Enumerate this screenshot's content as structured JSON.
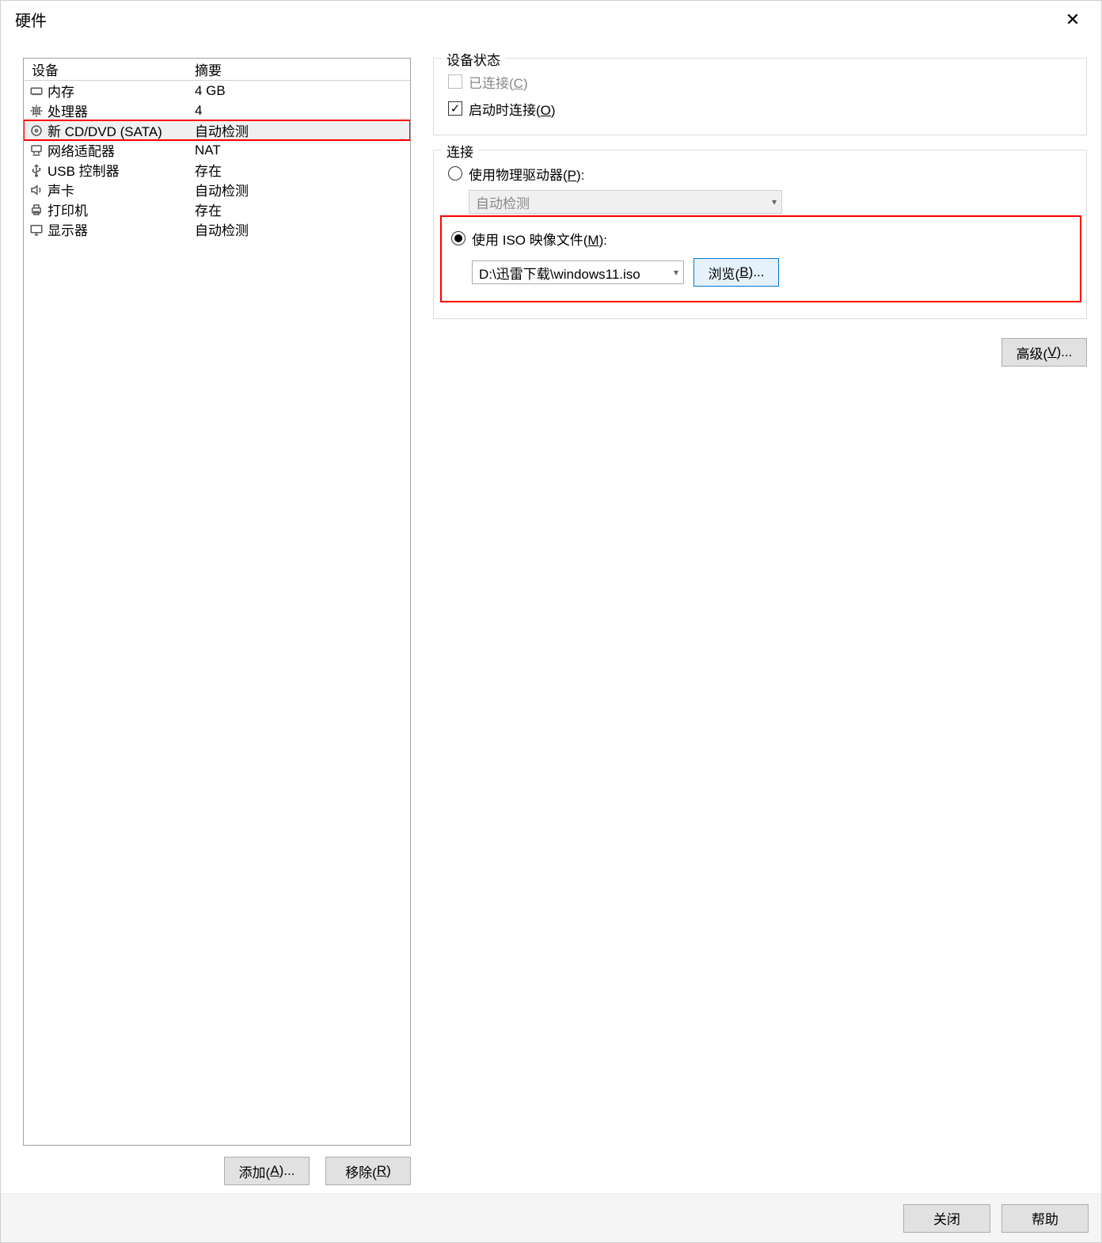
{
  "title": "硬件",
  "device_table": {
    "headers": {
      "device": "设备",
      "summary": "摘要"
    },
    "rows": [
      {
        "icon": "memory",
        "label": "内存",
        "summary": "4 GB",
        "selected": false
      },
      {
        "icon": "cpu",
        "label": "处理器",
        "summary": "4",
        "selected": false
      },
      {
        "icon": "disc",
        "label": "新 CD/DVD (SATA)",
        "summary": "自动检测",
        "selected": true,
        "highlight": true
      },
      {
        "icon": "network",
        "label": "网络适配器",
        "summary": "NAT",
        "selected": false
      },
      {
        "icon": "usb",
        "label": "USB 控制器",
        "summary": "存在",
        "selected": false
      },
      {
        "icon": "sound",
        "label": "声卡",
        "summary": "自动检测",
        "selected": false
      },
      {
        "icon": "printer",
        "label": "打印机",
        "summary": "存在",
        "selected": false
      },
      {
        "icon": "display",
        "label": "显示器",
        "summary": "自动检测",
        "selected": false
      }
    ]
  },
  "buttons": {
    "add": {
      "pre": "添加(",
      "u": "A",
      "post": ")..."
    },
    "remove": {
      "pre": "移除(",
      "u": "R",
      "post": ")"
    },
    "browse": {
      "pre": "浏览(",
      "u": "B",
      "post": ")..."
    },
    "advanced": {
      "pre": "高级(",
      "u": "V",
      "post": ")..."
    },
    "close": "关闭",
    "help": "帮助"
  },
  "device_status": {
    "legend": "设备状态",
    "connected": {
      "pre": "已连接(",
      "u": "C",
      "post": ")",
      "checked": false,
      "enabled": false
    },
    "connect_poweron": {
      "pre": "启动时连接(",
      "u": "O",
      "post": ")",
      "checked": true,
      "enabled": true
    }
  },
  "connection": {
    "legend": "连接",
    "physical": {
      "pre": "使用物理驱动器(",
      "u": "P",
      "post": "):",
      "selected": false,
      "dropdown_value": "自动检测"
    },
    "iso": {
      "pre": "使用 ISO 映像文件(",
      "u": "M",
      "post": "):",
      "selected": true,
      "path": "D:\\迅雷下载\\windows11.iso"
    }
  }
}
